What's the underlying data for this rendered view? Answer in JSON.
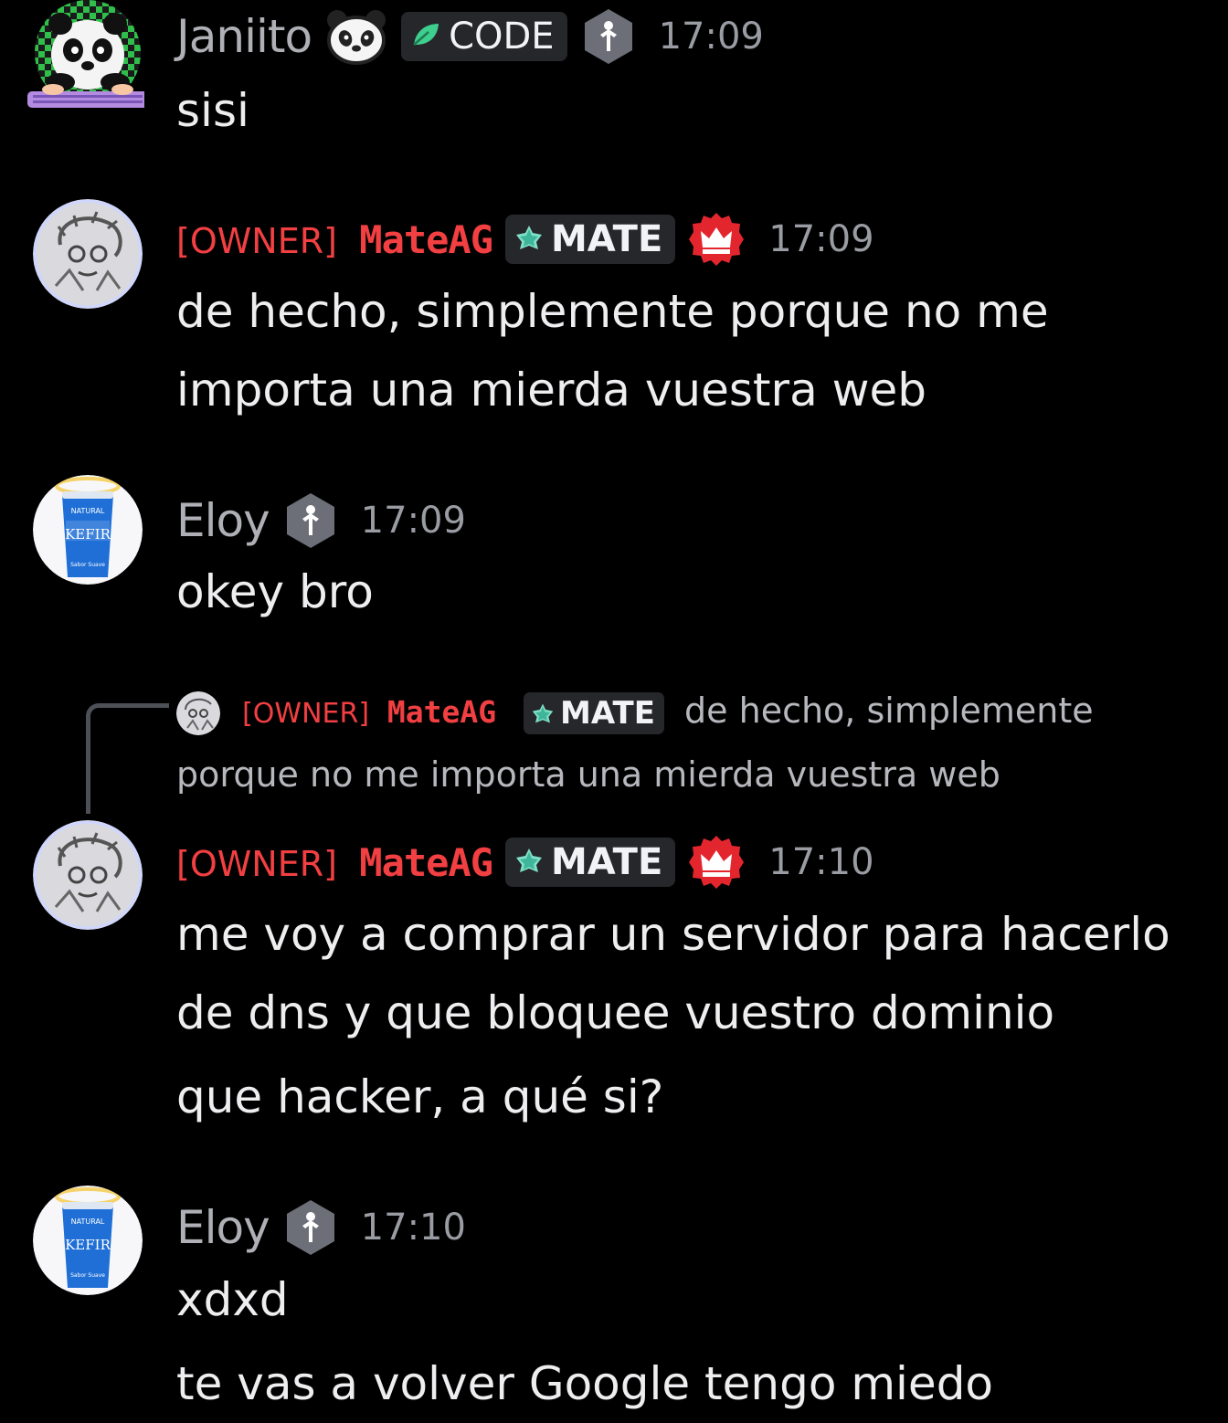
{
  "colors": {
    "background": "#000000",
    "owner_red": "#f23f42",
    "username_gray": "#aeb0b6",
    "timestamp_gray": "#9a9ca3",
    "tag_bg": "#26272b"
  },
  "messages": [
    {
      "author": "Janiito",
      "author_emoji": "panda-face-icon",
      "tag": "CODE",
      "tag_icon": "leaf-icon",
      "badge": "hex-person-badge-icon",
      "time": "17:09",
      "lines": [
        "sisi"
      ]
    },
    {
      "author_prefix": "[OWNER]",
      "author": "MateAG",
      "tag": "MATE",
      "tag_icon": "gem-icon",
      "badge": "crown-badge-icon",
      "time": "17:09",
      "lines": [
        "de hecho, simplemente porque no me",
        "importa una mierda vuestra web"
      ]
    },
    {
      "author": "Eloy",
      "badge": "hex-person-badge-icon",
      "time": "17:09",
      "lines": [
        "okey bro"
      ]
    },
    {
      "reply": {
        "author_prefix": "[OWNER]",
        "author": "MateAG",
        "tag": "MATE",
        "text_line1": "de hecho, simplemente",
        "text_line2": "porque no me importa una mierda vuestra web"
      },
      "author_prefix": "[OWNER]",
      "author": "MateAG",
      "tag": "MATE",
      "tag_icon": "gem-icon",
      "badge": "crown-badge-icon",
      "time": "17:10",
      "lines": [
        "me voy a comprar un servidor para hacerlo",
        "de dns y que bloquee vuestro dominio"
      ],
      "followup": [
        "que hacker, a qué si?"
      ]
    },
    {
      "author": "Eloy",
      "badge": "hex-person-badge-icon",
      "time": "17:10",
      "lines": [
        "xdxd"
      ],
      "followup": [
        "te vas a volver Google tengo miedo"
      ]
    }
  ]
}
